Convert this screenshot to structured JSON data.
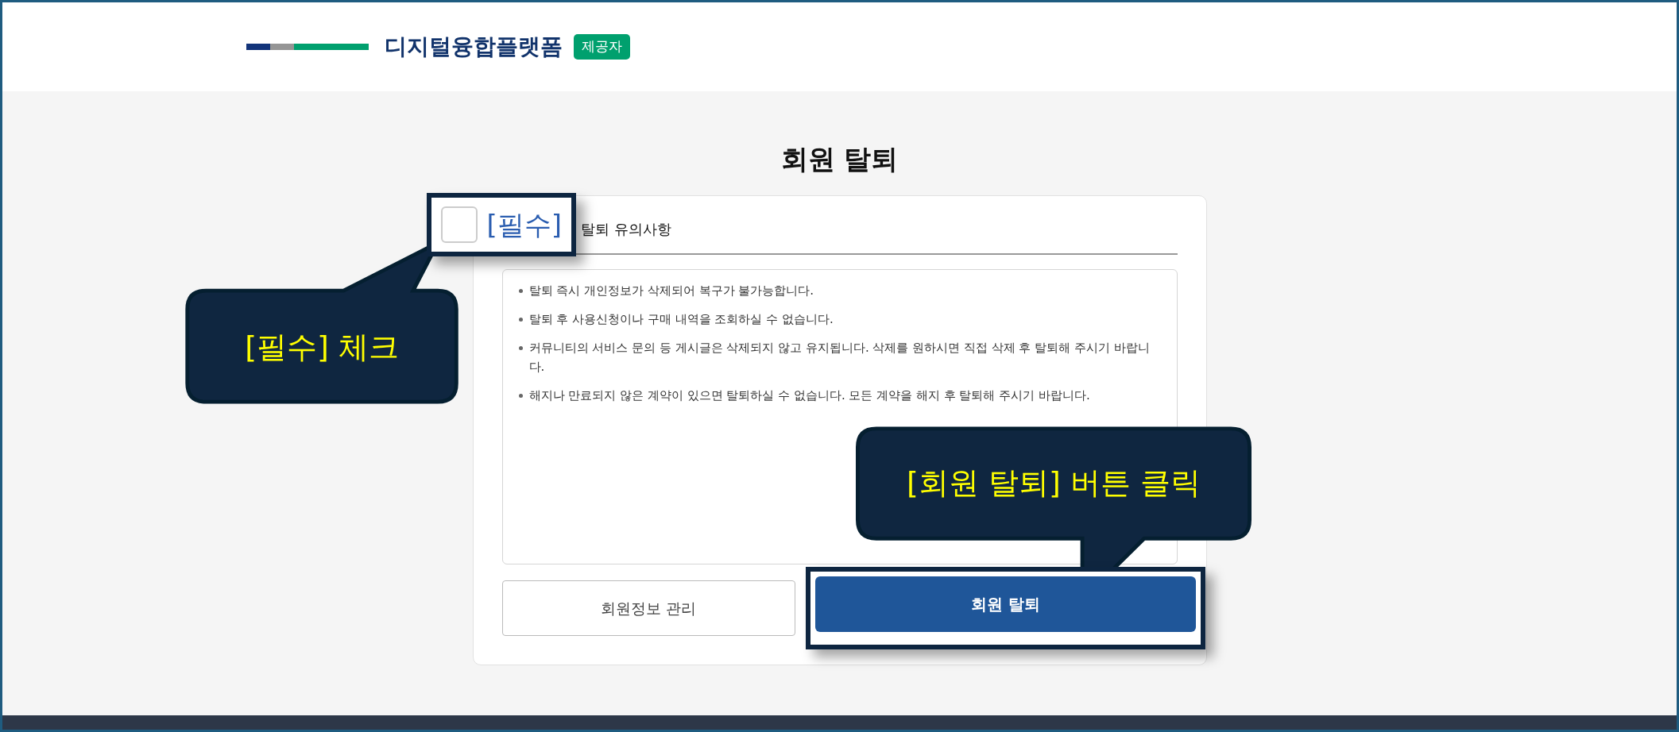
{
  "header": {
    "logo_text": "디지털융합플랫폼",
    "badge": "제공자"
  },
  "page_title": "회원 탈퇴",
  "agreement": {
    "tag": "[필수]",
    "label": "탈퇴 유의사항",
    "checked": false,
    "highlighted": true
  },
  "notices": [
    "탈퇴 즉시 개인정보가 삭제되어 복구가 불가능합니다.",
    "탈퇴 후 사용신청이나 구매 내역을 조회하실 수 없습니다.",
    "커뮤니티의 서비스 문의 등 게시글은 삭제되지 않고 유지됩니다. 삭제를 원하시면 직접 삭제 후 탈퇴해 주시기 바랍니다.",
    "해지나 만료되지 않은 계약이 있으면 탈퇴하실 수 없습니다. 모든 계약을 해지 후 탈퇴해 주시기 바랍니다."
  ],
  "buttons": [
    {
      "label": "회원정보 관리",
      "kind": "secondary",
      "highlighted": false
    },
    {
      "label": "회원 탈퇴",
      "kind": "primary",
      "highlighted": true
    }
  ],
  "callouts": [
    {
      "text": "[필수] 체크"
    },
    {
      "text": "[회원 탈퇴] 버튼 클릭"
    }
  ]
}
